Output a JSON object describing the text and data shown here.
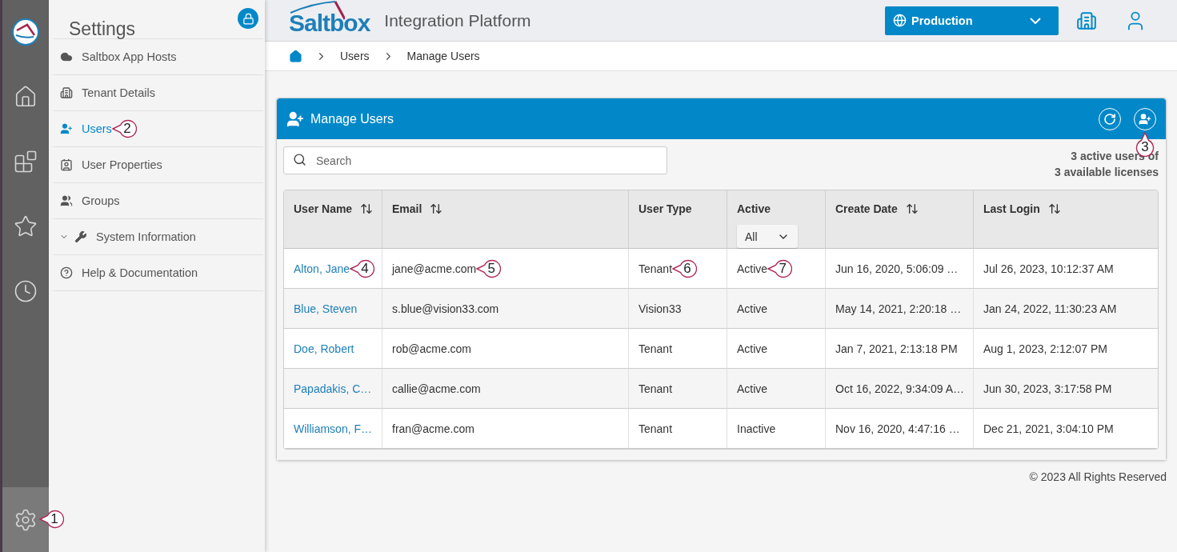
{
  "rail": [
    {
      "kind": "logo",
      "selected": false
    },
    {
      "kind": "home",
      "selected": false
    },
    {
      "kind": "apps",
      "selected": false
    },
    {
      "kind": "favorites",
      "selected": false
    },
    {
      "kind": "history",
      "selected": false
    },
    {
      "kind": "settings",
      "selected": true,
      "callout": "1"
    }
  ],
  "sidebar": {
    "title": "Settings",
    "items": [
      {
        "label": "Saltbox App Hosts",
        "kind": "cloud",
        "selected": false
      },
      {
        "label": "Tenant Details",
        "kind": "building",
        "selected": false
      },
      {
        "label": "Users",
        "kind": "user-add",
        "selected": true,
        "callout": "2"
      },
      {
        "label": "User Properties",
        "kind": "id-card",
        "selected": false
      },
      {
        "label": "Groups",
        "kind": "group-add",
        "selected": false
      },
      {
        "label": "System Information",
        "kind": "wrench",
        "selected": false,
        "expanded": false
      },
      {
        "label": "Help & Documentation",
        "kind": "help",
        "selected": false
      }
    ]
  },
  "header": {
    "brand": "Saltbox",
    "title": "Integration Platform",
    "environment": "Production"
  },
  "breadcrumb": [
    "Users",
    "Manage Users"
  ],
  "panel": {
    "title": "Manage Users",
    "callout": "3",
    "search": {
      "placeholder": "Search"
    },
    "license_lines": [
      "3 active users of",
      "3 available licenses"
    ],
    "table": {
      "columns": [
        {
          "label": "User Name",
          "sortable": true
        },
        {
          "label": "Email",
          "sortable": true
        },
        {
          "label": "User Type",
          "sortable": false
        },
        {
          "label": "Active",
          "sortable": false,
          "filter": "All"
        },
        {
          "label": "Create Date",
          "sortable": true
        },
        {
          "label": "Last Login",
          "sortable": true
        }
      ],
      "rows": [
        {
          "cells": [
            {
              "text": "Alton, Jane",
              "callout": "4"
            },
            {
              "text": "jane@acme.com",
              "callout": "5"
            },
            {
              "text": "Tenant",
              "callout": "6"
            },
            {
              "text": "Active",
              "callout": "7"
            },
            {
              "text": "Jun 16, 2020, 5:06:09 …"
            },
            {
              "text": "Jul 26, 2023, 10:12:37 AM"
            }
          ]
        },
        {
          "cells": [
            {
              "text": "Blue, Steven"
            },
            {
              "text": "s.blue@vision33.com"
            },
            {
              "text": "Vision33"
            },
            {
              "text": "Active"
            },
            {
              "text": "May 14, 2021, 2:20:18 …"
            },
            {
              "text": "Jan 24, 2022, 11:30:23 AM"
            }
          ]
        },
        {
          "cells": [
            {
              "text": "Doe, Robert"
            },
            {
              "text": "rob@acme.com"
            },
            {
              "text": "Tenant"
            },
            {
              "text": "Active"
            },
            {
              "text": "Jan 7, 2021, 2:13:18 PM"
            },
            {
              "text": "Aug 1, 2023, 2:12:07 PM"
            }
          ]
        },
        {
          "cells": [
            {
              "text": "Papadakis, C…"
            },
            {
              "text": "callie@acme.com"
            },
            {
              "text": "Tenant"
            },
            {
              "text": "Active"
            },
            {
              "text": "Oct 16, 2022, 9:34:09 A…"
            },
            {
              "text": "Jun 30, 2023, 3:17:58 PM"
            }
          ]
        },
        {
          "cells": [
            {
              "text": "Williamson, F…"
            },
            {
              "text": "fran@acme.com"
            },
            {
              "text": "Tenant"
            },
            {
              "text": "Inactive"
            },
            {
              "text": "Nov 16, 2020, 4:47:16 …"
            },
            {
              "text": "Dec 21, 2021, 3:04:10 PM"
            }
          ]
        }
      ]
    }
  },
  "footer": "© 2023 All Rights Reserved"
}
